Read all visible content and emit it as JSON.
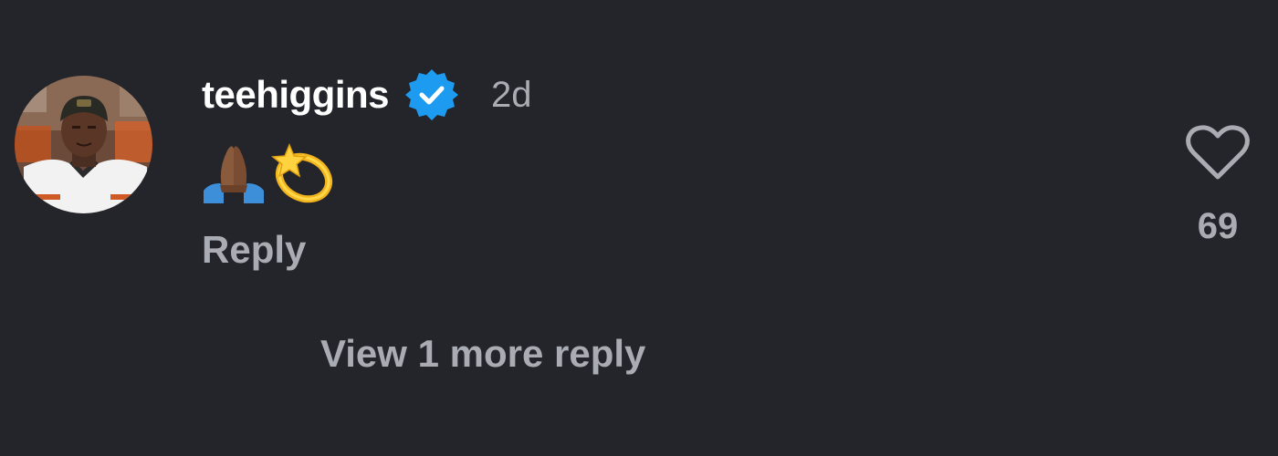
{
  "comment": {
    "username": "teehiggins",
    "verified_icon": "verified-badge-icon",
    "timestamp": "2d",
    "text": "🙏🏾💫",
    "reply_label": "Reply",
    "like_icon": "heart-outline-icon",
    "like_count": "69",
    "view_more_label": "View 1 more reply"
  },
  "colors": {
    "background": "#24252b",
    "username": "#ffffff",
    "secondary_text": "#a9acb3",
    "verified_badge": "#1d9bf0"
  }
}
